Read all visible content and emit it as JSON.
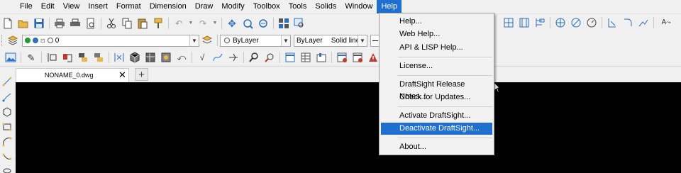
{
  "menubar": {
    "items": [
      "File",
      "Edit",
      "View",
      "Insert",
      "Format",
      "Dimension",
      "Draw",
      "Modify",
      "Toolbox",
      "Tools",
      "Solids",
      "Window",
      "Help"
    ],
    "active": "Help"
  },
  "layer_combo": {
    "value": "0"
  },
  "color_combo": {
    "value": "ByLayer"
  },
  "linestyle_combo": {
    "value": "ByLayer",
    "style": "Solid line"
  },
  "document_tab": {
    "name": "NONAME_0.dwg",
    "close": "✕"
  },
  "new_tab": {
    "label": "+"
  },
  "help_menu": {
    "items": [
      "Help...",
      "Web Help...",
      "API & LISP Help...",
      "License...",
      "DraftSight Release Notes...",
      "Check for Updates...",
      "Activate DraftSight...",
      "Deactivate DraftSight...",
      "About..."
    ],
    "highlighted": "Deactivate DraftSight..."
  },
  "colors": {
    "accent": "#1f6fd1",
    "canvas": "#000000",
    "chrome": "#f0f0f0"
  },
  "icons": {
    "toolbar1": [
      "new-icon",
      "open-icon",
      "save-icon",
      "print-icon",
      "plot-icon",
      "preview-icon",
      "cut-icon",
      "copy-icon",
      "paste-icon",
      "match-props-icon",
      "undo-icon",
      "redo-icon",
      "pan-icon",
      "zoom-window-icon",
      "zoom-realtime-icon",
      "design-resources-icon",
      "find-icon"
    ],
    "right_tools": [
      "block-icon",
      "hatch-icon",
      "table-icon",
      "snap-icon",
      "osnap-icon",
      "circle-icon",
      "dimension-icon",
      "fillet-icon",
      "line-icon",
      "text-icon"
    ]
  }
}
